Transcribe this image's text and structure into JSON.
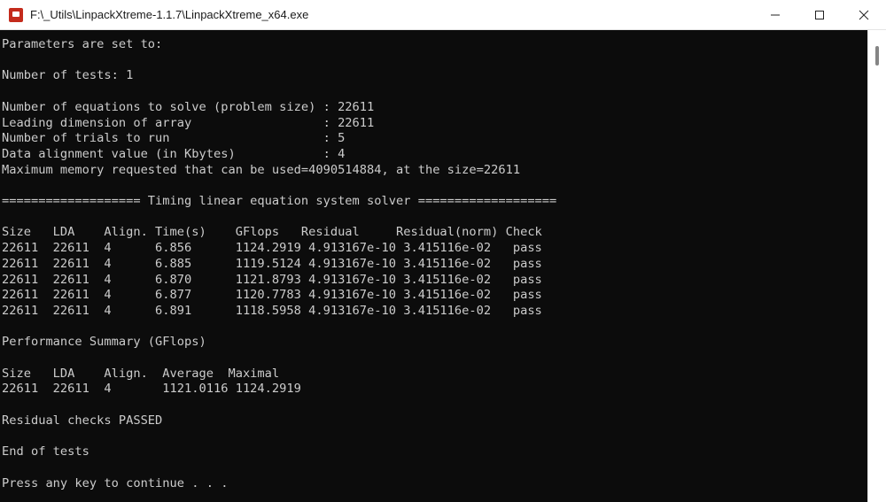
{
  "window": {
    "title": "F:\\_Utils\\LinpackXtreme-1.1.7\\LinpackXtreme_x64.exe",
    "icon": "console-app-icon"
  },
  "caption_buttons": {
    "minimize_icon": "minimize-icon",
    "maximize_icon": "maximize-icon",
    "close_icon": "close-icon"
  },
  "console": {
    "lines": [
      "Parameters are set to:",
      "",
      "Number of tests: 1",
      "",
      "Number of equations to solve (problem size) : 22611",
      "Leading dimension of array                  : 22611",
      "Number of trials to run                     : 5",
      "Data alignment value (in Kbytes)            : 4",
      "Maximum memory requested that can be used=4090514884, at the size=22611",
      "",
      "=================== Timing linear equation system solver ===================",
      "",
      "Size   LDA    Align. Time(s)    GFlops   Residual     Residual(norm) Check",
      "22611  22611  4      6.856      1124.2919 4.913167e-10 3.415116e-02   pass",
      "22611  22611  4      6.885      1119.5124 4.913167e-10 3.415116e-02   pass",
      "22611  22611  4      6.870      1121.8793 4.913167e-10 3.415116e-02   pass",
      "22611  22611  4      6.877      1120.7783 4.913167e-10 3.415116e-02   pass",
      "22611  22611  4      6.891      1118.5958 4.913167e-10 3.415116e-02   pass",
      "",
      "Performance Summary (GFlops)",
      "",
      "Size   LDA    Align.  Average  Maximal",
      "22611  22611  4       1121.0116 1124.2919",
      "",
      "Residual checks PASSED",
      "",
      "End of tests",
      "",
      "Press any key to continue . . ."
    ]
  }
}
